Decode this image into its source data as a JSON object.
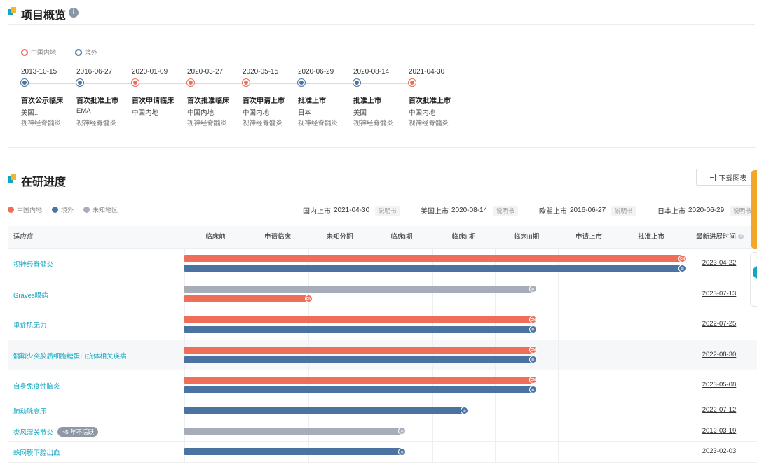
{
  "overview": {
    "title": "项目概览",
    "info_icon": "i"
  },
  "overview_legend": [
    {
      "label": "中国内地",
      "color": "#ee6e5a"
    },
    {
      "label": "境外",
      "color": "#4b73a2"
    }
  ],
  "timeline": [
    {
      "date": "2013-10-15",
      "event": "首次公示临床",
      "region": "美国...",
      "indication": "视神经脊髓炎",
      "color": "#4b73a2"
    },
    {
      "date": "2016-06-27",
      "event": "首次批准上市",
      "region": "EMA",
      "indication": "视神经脊髓炎",
      "color": "#4b73a2"
    },
    {
      "date": "2020-01-09",
      "event": "首次申请临床",
      "region": "中国内地",
      "indication": "",
      "color": "#ee6e5a"
    },
    {
      "date": "2020-03-27",
      "event": "首次批准临床",
      "region": "中国内地",
      "indication": "视神经脊髓炎",
      "color": "#ee6e5a"
    },
    {
      "date": "2020-05-15",
      "event": "首次申请上市",
      "region": "中国内地",
      "indication": "视神经脊髓炎",
      "color": "#ee6e5a"
    },
    {
      "date": "2020-06-29",
      "event": "批准上市",
      "region": "日本",
      "indication": "视神经脊髓炎",
      "color": "#4b73a2"
    },
    {
      "date": "2020-08-14",
      "event": "批准上市",
      "region": "美国",
      "indication": "视神经脊髓炎",
      "color": "#4b73a2"
    },
    {
      "date": "2021-04-30",
      "event": "首次批准上市",
      "region": "中国内地",
      "indication": "视神经脊髓炎",
      "color": "#ee6e5a"
    }
  ],
  "progress": {
    "title": "在研进度",
    "download_label": "下载图表"
  },
  "progress_legend": [
    {
      "label": "中国内地",
      "color": "#ee6e5a"
    },
    {
      "label": "境外",
      "color": "#4b73a2"
    },
    {
      "label": "未知地区",
      "color": "#a6adb8"
    }
  ],
  "launches": [
    {
      "label": "国内上市",
      "date": "2021-04-30",
      "tag": "说明书"
    },
    {
      "label": "美国上市",
      "date": "2020-08-14",
      "tag": "说明书"
    },
    {
      "label": "欧盟上市",
      "date": "2016-06-27",
      "tag": "说明书"
    },
    {
      "label": "日本上市",
      "date": "2020-06-29",
      "tag": "说明书"
    }
  ],
  "table": {
    "headers": [
      "适应症",
      "临床前",
      "申请临床",
      "未知分期",
      "临床I期",
      "临床II期",
      "临床III期",
      "申请上市",
      "批准上市",
      "最新进展时间"
    ],
    "stages": [
      "临床前",
      "申请临床",
      "未知分期",
      "临床I期",
      "临床II期",
      "临床III期",
      "申请上市",
      "批准上市"
    ],
    "rows": [
      {
        "name": "视神经脊髓炎",
        "tag": "",
        "bars": [
          {
            "region": "cn",
            "stage_progress": 8
          },
          {
            "region": "os",
            "stage_progress": 8
          }
        ],
        "date": "2023-04-22"
      },
      {
        "name": "Graves眼病",
        "tag": "",
        "bars": [
          {
            "region": "unk",
            "stage_progress": 5.6
          },
          {
            "region": "cn",
            "stage_progress": 2
          }
        ],
        "date": "2023-07-13"
      },
      {
        "name": "重症肌无力",
        "tag": "",
        "bars": [
          {
            "region": "cn",
            "stage_progress": 5.6
          },
          {
            "region": "os",
            "stage_progress": 5.6
          }
        ],
        "date": "2022-07-25"
      },
      {
        "name": "髓鞘少突胶质细胞糖蛋白抗体相关疾病",
        "tag": "",
        "bars": [
          {
            "region": "cn",
            "stage_progress": 5.6
          },
          {
            "region": "os",
            "stage_progress": 5.6
          }
        ],
        "date": "2022-08-30"
      },
      {
        "name": "自身免疫性脑炎",
        "tag": "",
        "bars": [
          {
            "region": "cn",
            "stage_progress": 5.6
          },
          {
            "region": "os",
            "stage_progress": 5.6
          }
        ],
        "date": "2023-05-08"
      },
      {
        "name": "肺动脉高压",
        "tag": "",
        "bars": [
          {
            "region": "os",
            "stage_progress": 4.5
          }
        ],
        "date": "2022-07-12"
      },
      {
        "name": "类风湿关节炎",
        "tag": ">5 年不活跃",
        "bars": [
          {
            "region": "unk",
            "stage_progress": 3.5
          }
        ],
        "date": "2012-03-19"
      },
      {
        "name": "蛛网膜下腔出血",
        "tag": "",
        "bars": [
          {
            "region": "os",
            "stage_progress": 3.5
          }
        ],
        "date": "2023-02-03"
      }
    ]
  },
  "region_colors": {
    "cn": "#ee6e5a",
    "os": "#4b73a2",
    "unk": "#a6adb8"
  },
  "region_marks": {
    "cn": "CN",
    "os": "◍",
    "unk": "◍"
  }
}
